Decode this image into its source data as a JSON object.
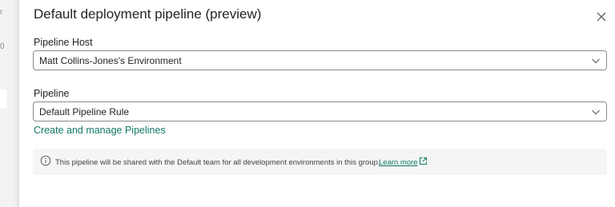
{
  "backdrop": {
    "frag1": "r",
    "frag2": "0"
  },
  "dialog": {
    "title": "Default deployment pipeline (preview)",
    "close_icon": "close-icon"
  },
  "host": {
    "label": "Pipeline Host",
    "value": "Matt Collins-Jones's Environment"
  },
  "pipeline": {
    "label": "Pipeline",
    "value": "Default Pipeline Rule"
  },
  "manage_link": "Create and manage Pipelines",
  "info": {
    "icon": "info-icon",
    "message": "This pipeline will be shared with the Default team for all development environments in this group.",
    "learn_more": "Learn more",
    "external_icon": "external-link-icon"
  },
  "colors": {
    "accent": "#117865",
    "border": "#8a8a8a",
    "info_bg": "#f5f5f5"
  }
}
